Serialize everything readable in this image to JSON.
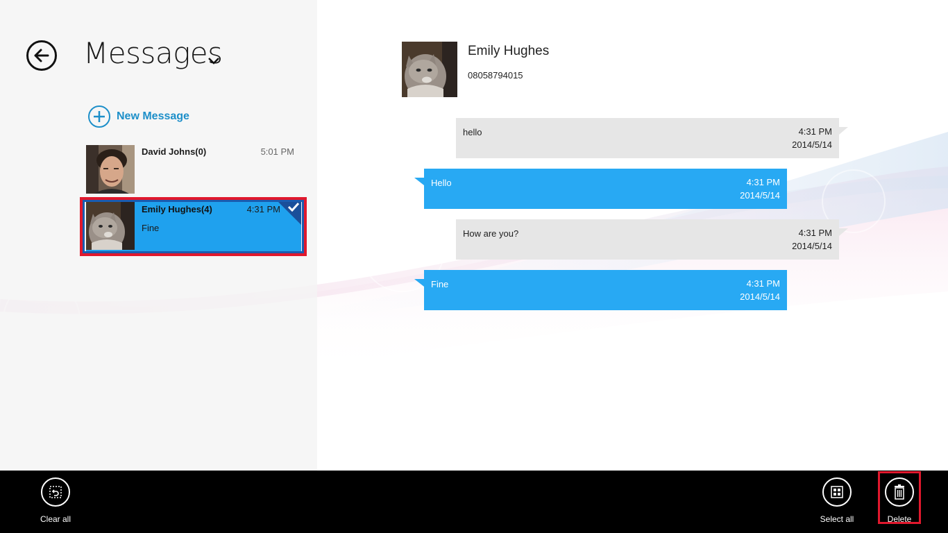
{
  "header": {
    "title": "Messages"
  },
  "actions": {
    "new_message_label": "New Message"
  },
  "conversations": [
    {
      "name": "David Johns(0)",
      "time": "5:01 PM",
      "preview": "",
      "selected": false
    },
    {
      "name": "Emily Hughes(4)",
      "time": "4:31 PM",
      "preview": "Fine",
      "selected": true
    }
  ],
  "contact": {
    "name": "Emily Hughes",
    "phone": "08058794015"
  },
  "messages": [
    {
      "direction": "in",
      "text": "hello",
      "time": "4:31 PM",
      "date": "2014/5/14"
    },
    {
      "direction": "out",
      "text": "Hello",
      "time": "4:31 PM",
      "date": "2014/5/14"
    },
    {
      "direction": "in",
      "text": "How are you?",
      "time": "4:31 PM",
      "date": "2014/5/14"
    },
    {
      "direction": "out",
      "text": "Fine",
      "time": "4:31 PM",
      "date": "2014/5/14"
    }
  ],
  "app_bar": {
    "clear_all_label": "Clear all",
    "select_all_label": "Select all",
    "delete_label": "Delete"
  },
  "icons": {
    "back": "back-arrow-icon",
    "chevron": "chevron-down-icon",
    "new_message": "plus-icon",
    "clear_all": "clear-all-icon",
    "select_all": "select-all-icon",
    "delete": "trash-icon",
    "check": "checkmark-icon"
  },
  "colors": {
    "accent": "#1d8fc9",
    "selected_item": "#1fa1ee",
    "outgoing_bubble": "#28a9f3",
    "incoming_bubble": "#e6e6e6",
    "highlight_outline": "#e0182d",
    "app_bar": "#000000"
  }
}
